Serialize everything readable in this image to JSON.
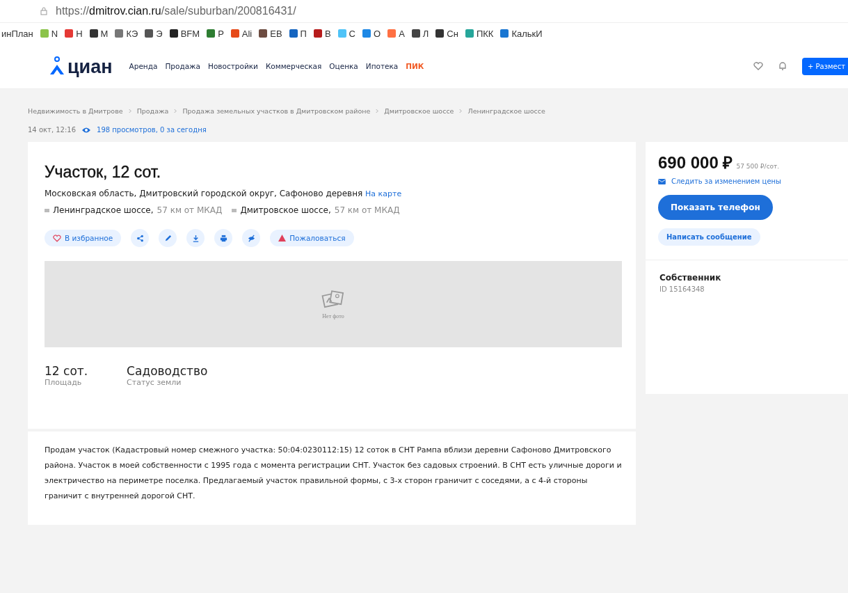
{
  "browser": {
    "url_host": "https://dmitrov.cian.ru",
    "url_path": "/sale/suburban/200816431/",
    "bookmarks": [
      {
        "label": "инПлан"
      },
      {
        "label": "N",
        "color": "#8bc34a"
      },
      {
        "label": "Н",
        "color": "#e53935"
      },
      {
        "label": "М",
        "color": "#333333"
      },
      {
        "label": "КЭ",
        "color": "#777777"
      },
      {
        "label": "Э",
        "color": "#555555"
      },
      {
        "label": "BFM",
        "color": "#222222"
      },
      {
        "label": "Р",
        "color": "#2e7d32"
      },
      {
        "label": "Ali",
        "color": "#e64a19"
      },
      {
        "label": "ЕВ",
        "color": "#6d4c41"
      },
      {
        "label": "П",
        "color": "#1565c0"
      },
      {
        "label": "В",
        "color": "#b71c1c"
      },
      {
        "label": "С",
        "color": "#4fc3f7"
      },
      {
        "label": "О",
        "color": "#1e88e5"
      },
      {
        "label": "А",
        "color": "#ff7043"
      },
      {
        "label": "Л",
        "color": "#444444"
      },
      {
        "label": "Сн",
        "color": "#333333"
      },
      {
        "label": "ПКК",
        "color": "#26a69a"
      },
      {
        "label": "КалькИ",
        "color": "#1976d2"
      }
    ]
  },
  "header": {
    "logo": "циан",
    "nav": [
      {
        "label": "Аренда",
        "kind": "plain"
      },
      {
        "label": "Продажа",
        "kind": "plain"
      },
      {
        "label": "Новостройки",
        "kind": "plain"
      },
      {
        "label": "Коммерческая",
        "kind": "plain"
      },
      {
        "label": "Оценка",
        "kind": "plain"
      },
      {
        "label": "Ипотека",
        "kind": "plain"
      },
      {
        "label": "ПИК",
        "kind": "brand"
      }
    ],
    "post_button": "+ Размест"
  },
  "breadcrumbs": [
    "Недвижимость в Дмитрове",
    "Продажа",
    "Продажа земельных участков в Дмитровском районе",
    "Дмитровское шоссе",
    "Ленинградское шоссе"
  ],
  "meta": {
    "date": "14 окт, 12:16",
    "views": "198 просмотров, 0 за сегодня"
  },
  "listing": {
    "title": "Участок, 12 сот.",
    "address": "Московская область, Дмитровский городской округ, Сафоново деревня",
    "map_link": "На карте",
    "highways": [
      {
        "name": "Ленинградское шоссе,",
        "distance": "57 км от МКАД"
      },
      {
        "name": "Дмитровское шоссе,",
        "distance": "57 км от МКАД"
      }
    ],
    "favorite": "В избранное",
    "complain": "Пожаловаться",
    "no_photo": "Нет фото",
    "facts": [
      {
        "value": "12 сот.",
        "label": "Площадь"
      },
      {
        "value": "Садоводство",
        "label": "Статус земли"
      }
    ],
    "description": "Продам участок (Кадастровый номер смежного участка: 50:04:0230112:15) 12 соток в СНТ Рампа вблизи деревни Сафоново Дмитровского района. Участок в моей собственности с 1995 года с момента регистрации СНТ. Участок без садовых строений. В СНТ есть уличные дороги и электричество на периметре поселка. Предлагаемый участок правильной формы, с 3-х сторон граничит с соседями, а с 4-й стороны граничит с внутренней дорогой СНТ."
  },
  "sidebar": {
    "price": "690 000 ₽",
    "price_per": "57 500 ₽/сот.",
    "watch": "Следить за изменением цены",
    "show_phone": "Показать телефон",
    "message": "Написать сообщение",
    "owner": "Собственник",
    "owner_id": "ID 15164348"
  }
}
